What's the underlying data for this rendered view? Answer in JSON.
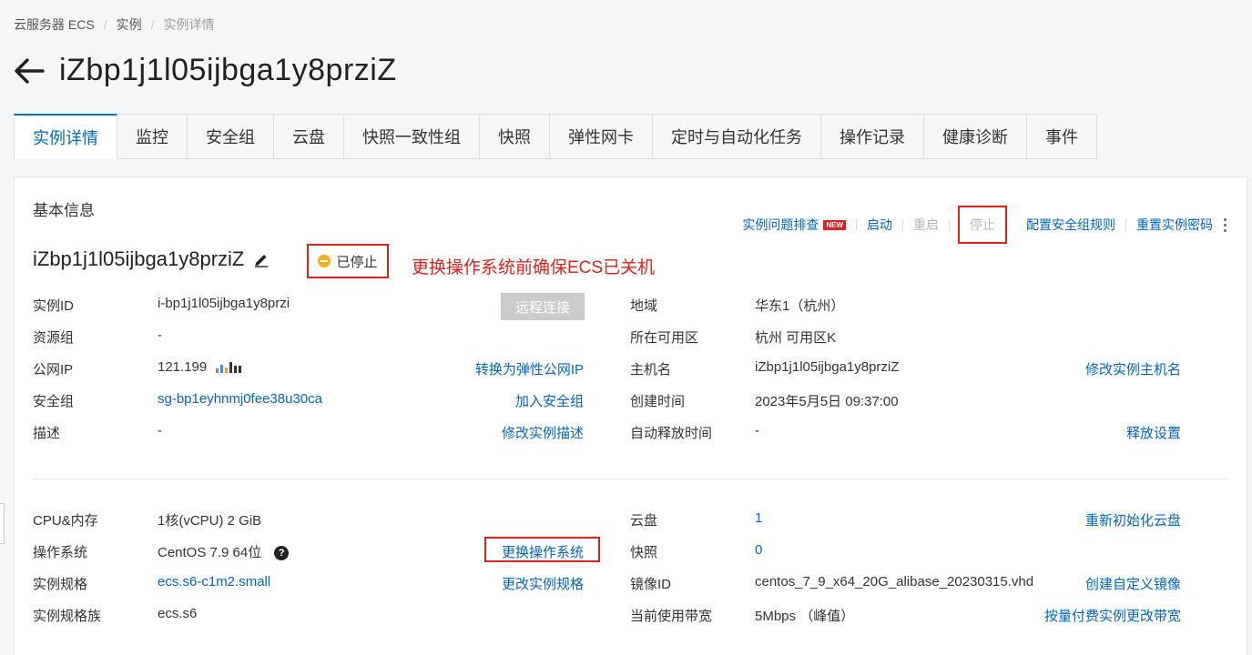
{
  "breadcrumb": {
    "item1": "云服务器 ECS",
    "item2": "实例",
    "item3": "实例详情"
  },
  "page_title": "iZbp1j1l05ijbga1y8prziZ",
  "tabs": [
    "实例详情",
    "监控",
    "安全组",
    "云盘",
    "快照一致性组",
    "快照",
    "弹性网卡",
    "定时与自动化任务",
    "操作记录",
    "健康诊断",
    "事件"
  ],
  "basic": {
    "section_title": "基本信息",
    "actions": {
      "troubleshoot": "实例问题排查",
      "new_badge": "NEW",
      "start": "启动",
      "restart": "重启",
      "stop": "停止",
      "config_sg": "配置安全组规则",
      "reset_pwd": "重置实例密码"
    },
    "instance_name": "iZbp1j1l05ijbga1y8prziZ",
    "status": "已停止",
    "annotation": "更换操作系统前确保ECS已关机",
    "remote_connect": "远程连接",
    "left": [
      {
        "label": "实例ID",
        "value": "i-bp1j1l05ijbga1y8przi",
        "link": ""
      },
      {
        "label": "资源组",
        "value": "-",
        "link": ""
      },
      {
        "label": "公网IP",
        "value": "121.199",
        "link": "转换为弹性公网IP"
      },
      {
        "label": "安全组",
        "value": "sg-bp1eyhnmj0fee38u30ca",
        "link": "加入安全组"
      },
      {
        "label": "描述",
        "value": "-",
        "link": "修改实例描述"
      }
    ],
    "right": [
      {
        "label": "地域",
        "value": "华东1（杭州）",
        "link": ""
      },
      {
        "label": "所在可用区",
        "value": "杭州 可用区K",
        "link": ""
      },
      {
        "label": "主机名",
        "value": "iZbp1j1l05ijbga1y8prziZ",
        "link": "修改实例主机名"
      },
      {
        "label": "创建时间",
        "value": "2023年5月5日 09:37:00",
        "link": ""
      },
      {
        "label": "自动释放时间",
        "value": "-",
        "link": "释放设置"
      }
    ]
  },
  "config": {
    "left": [
      {
        "label": "CPU&内存",
        "value": "1核(vCPU) 2 GiB",
        "link": ""
      },
      {
        "label": "操作系统",
        "value": "CentOS 7.9 64位",
        "link": "更换操作系统"
      },
      {
        "label": "实例规格",
        "value": "ecs.s6-c1m2.small",
        "link": "更改实例规格"
      },
      {
        "label": "实例规格族",
        "value": "ecs.s6",
        "link": ""
      }
    ],
    "right": [
      {
        "label": "云盘",
        "value": "1",
        "link": "重新初始化云盘"
      },
      {
        "label": "快照",
        "value": "0",
        "link": ""
      },
      {
        "label": "镜像ID",
        "value": "centos_7_9_x64_20G_alibase_20230315.vhd",
        "link": "创建自定义镜像"
      },
      {
        "label": "当前使用带宽",
        "value": "5Mbps （峰值）",
        "link": "按量付费实例更改带宽"
      }
    ]
  },
  "colors": {
    "link": "#0064c8",
    "highlight": "#e0201a",
    "status_stopped": "#f2b11d"
  }
}
